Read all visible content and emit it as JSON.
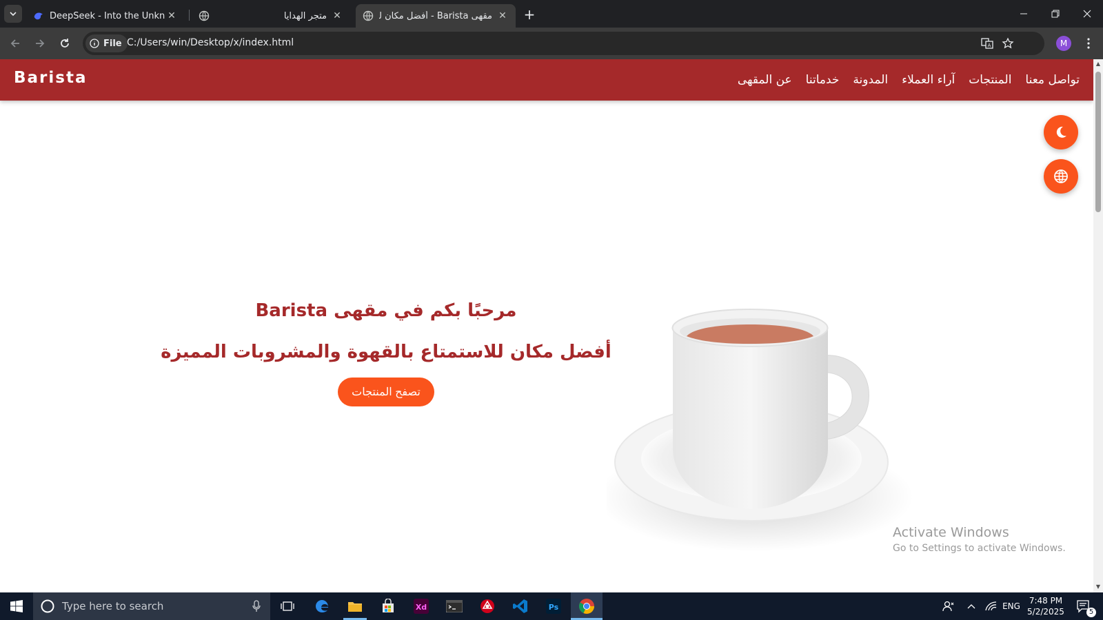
{
  "browser": {
    "tabs": [
      {
        "title": "DeepSeek - Into the Unknown",
        "icon": "deepseek-icon"
      },
      {
        "title": "متجر الهدايا",
        "icon": "globe-icon"
      },
      {
        "title": "مقهى Barista - أفضل مكان للاستـ",
        "icon": "globe-icon",
        "active": true
      }
    ],
    "chip_label": "File",
    "url": "C:/Users/win/Desktop/x/index.html",
    "profile_initial": "M"
  },
  "site": {
    "brand": "Barista",
    "nav": [
      "تواصل معنا",
      "المنتجات",
      "آراء العملاء",
      "المدونة",
      "خدماتنا",
      "عن المقهى"
    ],
    "hero_title": "مرحبًا بكم في مقهى Barista",
    "hero_subtitle": "أفضل مكان للاستمتاع بالقهوة والمشروبات المميزة",
    "cta_label": "تصفح المنتجات",
    "colors": {
      "primary": "#a5292a",
      "accent": "#fa541c"
    }
  },
  "watermark": {
    "title": "Activate Windows",
    "subtitle": "Go to Settings to activate Windows."
  },
  "taskbar": {
    "search_placeholder": "Type here to search",
    "lang": "ENG",
    "time": "7:48 PM",
    "date": "5/2/2025",
    "notification_count": "5"
  }
}
